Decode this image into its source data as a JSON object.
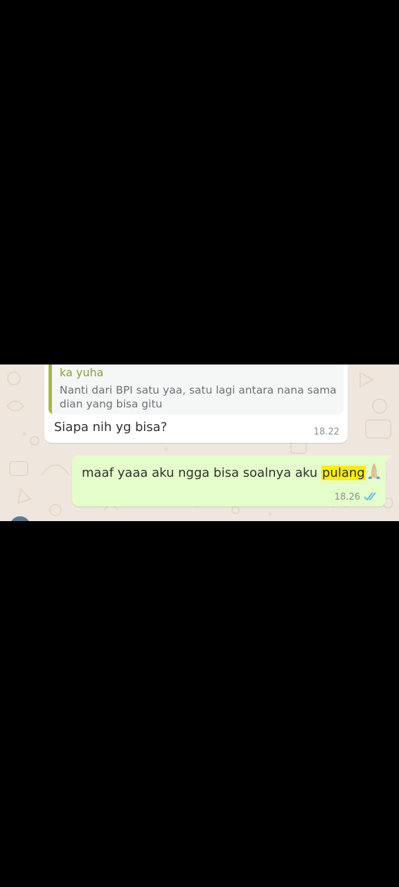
{
  "chat": {
    "incoming": {
      "quote_author": "ka yuha",
      "quote_text": "Nanti dari BPI satu yaa, satu lagi antara nana sama dian yang bisa gitu",
      "text": "Siapa nih yg bisa?",
      "time": "18.22"
    },
    "outgoing": {
      "text_before": "maaf yaaa aku ngga bisa soalnya aku ",
      "text_highlight": "pulang",
      "emoji_icon": "folded-hands-icon",
      "time": "18.26",
      "status_icon": "double-check-icon",
      "status_color": "#4fb6ec"
    }
  },
  "colors": {
    "outer_background": "#000000",
    "wallpaper": "#efe7de",
    "incoming_bubble": "#ffffff",
    "outgoing_bubble": "#e4fdcb",
    "quote_bar": "#a7ba3c",
    "quote_author": "#8fa135",
    "highlight": "#ffee00"
  }
}
